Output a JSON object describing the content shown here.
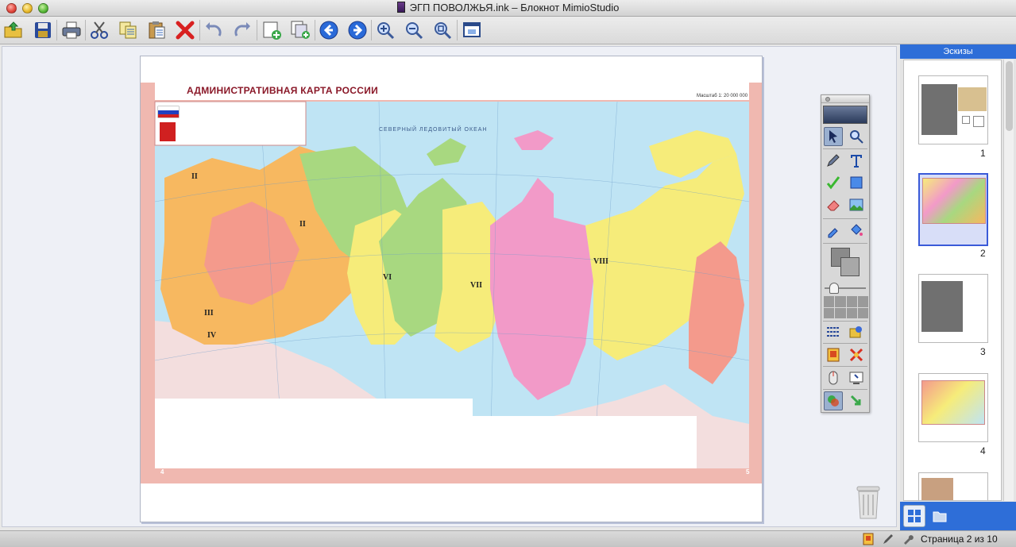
{
  "window": {
    "title": "ЭГП ПОВОЛЖЬЯ.ink – Блокнот MimioStudio"
  },
  "toolbar": {
    "buttons": [
      {
        "name": "open",
        "icon": "open-folder-icon"
      },
      {
        "name": "save",
        "icon": "floppy-disk-icon"
      },
      {
        "name": "print",
        "icon": "printer-icon"
      },
      {
        "name": "cut",
        "icon": "scissors-icon"
      },
      {
        "name": "copy",
        "icon": "copy-icon"
      },
      {
        "name": "paste",
        "icon": "clipboard-icon"
      },
      {
        "name": "delete",
        "icon": "red-x-icon"
      },
      {
        "name": "undo",
        "icon": "undo-icon"
      },
      {
        "name": "redo",
        "icon": "redo-icon"
      },
      {
        "name": "new-page",
        "icon": "add-page-icon"
      },
      {
        "name": "duplicate-page",
        "icon": "duplicate-page-icon"
      },
      {
        "name": "previous-page",
        "icon": "arrow-left-circle-icon"
      },
      {
        "name": "next-page",
        "icon": "arrow-right-circle-icon"
      },
      {
        "name": "zoom-in",
        "icon": "zoom-in-icon"
      },
      {
        "name": "zoom-out",
        "icon": "zoom-out-icon"
      },
      {
        "name": "zoom-fit",
        "icon": "zoom-fit-icon"
      },
      {
        "name": "fullscreen",
        "icon": "fullscreen-icon"
      }
    ]
  },
  "map": {
    "title": "АДМИНИСТРАТИВНАЯ КАРТА РОССИИ",
    "scale": "Масштаб 1: 20 000 000",
    "page_left": "4",
    "page_right": "5",
    "region_labels": [
      "II",
      "III",
      "VI",
      "VII",
      "VIII",
      "IV"
    ],
    "ocean_label": "СЕВЕРНЫЙ ЛЕДОВИТЫЙ ОКЕАН",
    "colors": {
      "water": "#bfe4f4",
      "yellow": "#f6ec7a",
      "pink": "#f29ac8",
      "green": "#a8d880",
      "orange": "#f7b860",
      "salmon": "#f49a8c",
      "foreign": "#f3dede",
      "frame": "#f0b8b0"
    }
  },
  "palette": {
    "tools": [
      {
        "name": "select-tool",
        "icon": "arrow-pointer-icon",
        "selected": true
      },
      {
        "name": "zoom-tool",
        "icon": "magnifier-icon"
      },
      {
        "name": "pen-tool",
        "icon": "pen-icon"
      },
      {
        "name": "text-tool",
        "icon": "text-t-icon"
      },
      {
        "name": "highlighter-tool",
        "icon": "checkmark-icon"
      },
      {
        "name": "shape-tool",
        "icon": "square-shape-icon"
      },
      {
        "name": "eraser-tool",
        "icon": "eraser-icon"
      },
      {
        "name": "image-tool",
        "icon": "image-icon"
      },
      {
        "name": "eyedropper-tool",
        "icon": "eyedropper-icon"
      },
      {
        "name": "fill-tool",
        "icon": "paint-bucket-icon"
      },
      {
        "name": "line-style-tool",
        "icon": "line-style-icon"
      },
      {
        "name": "gallery-tool",
        "icon": "gallery-icon"
      },
      {
        "name": "reveal-tool",
        "icon": "reveal-icon"
      },
      {
        "name": "spotlight-tool",
        "icon": "spotlight-icon"
      },
      {
        "name": "mouse-tool",
        "icon": "mouse-icon"
      },
      {
        "name": "screen-annotate-tool",
        "icon": "screen-annotate-icon"
      },
      {
        "name": "recorder-tool",
        "icon": "recorder-icon"
      },
      {
        "name": "insert-tool",
        "icon": "insert-icon"
      }
    ]
  },
  "sidebar": {
    "header": "Эскизы",
    "thumbnails": [
      {
        "number": "1",
        "selected": false
      },
      {
        "number": "2",
        "selected": true
      },
      {
        "number": "3",
        "selected": false
      },
      {
        "number": "4",
        "selected": false
      }
    ]
  },
  "status": {
    "page_indicator": "Страница 2 из 10"
  }
}
